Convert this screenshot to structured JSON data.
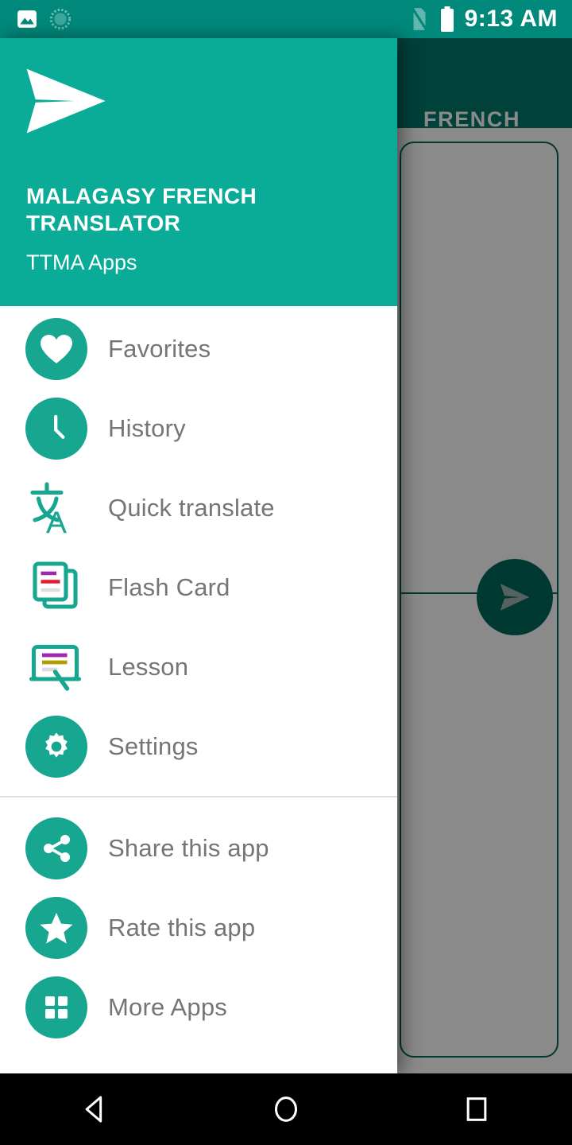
{
  "statusbar": {
    "time": "9:13 AM",
    "left_icons": [
      {
        "name": "photo-icon"
      },
      {
        "name": "sync-progress-icon"
      }
    ],
    "right_icons": [
      {
        "name": "no-sim-icon"
      },
      {
        "name": "battery-full-icon"
      }
    ],
    "background_color": "#00897b"
  },
  "background_app": {
    "toolbar_title": "FRENCH",
    "toolbar_color": "#00796b",
    "fab_icon": "send-icon",
    "fab_color": "#00695c",
    "scrim_color": "rgba(0,0,0,0.46)"
  },
  "drawer": {
    "header": {
      "logo_icon": "send-logo-icon",
      "title": "MALAGASY FRENCH TRANSLATOR",
      "subtitle": "TTMA Apps",
      "background_color": "#0aab97"
    },
    "accent_color": "#17a68f",
    "label_color": "#757575",
    "groups": [
      {
        "items": [
          {
            "label": "Favorites",
            "icon": "heart-icon",
            "style": "circle"
          },
          {
            "label": "History",
            "icon": "clock-icon",
            "style": "circle"
          },
          {
            "label": "Quick translate",
            "icon": "translate-icon",
            "style": "plain"
          },
          {
            "label": "Flash Card",
            "icon": "flash-card-icon",
            "style": "plain"
          },
          {
            "label": "Lesson",
            "icon": "lesson-board-icon",
            "style": "plain"
          },
          {
            "label": "Settings",
            "icon": "gear-icon",
            "style": "circle"
          }
        ]
      },
      {
        "items": [
          {
            "label": "Share this app",
            "icon": "share-icon",
            "style": "circle"
          },
          {
            "label": "Rate this app",
            "icon": "star-icon",
            "style": "circle"
          },
          {
            "label": "More Apps",
            "icon": "grid-icon",
            "style": "circle"
          }
        ]
      }
    ]
  },
  "navbar": {
    "buttons": [
      {
        "name": "back-button",
        "icon": "back-triangle-icon"
      },
      {
        "name": "home-button",
        "icon": "home-circle-icon"
      },
      {
        "name": "recents-button",
        "icon": "recents-square-icon"
      }
    ]
  }
}
